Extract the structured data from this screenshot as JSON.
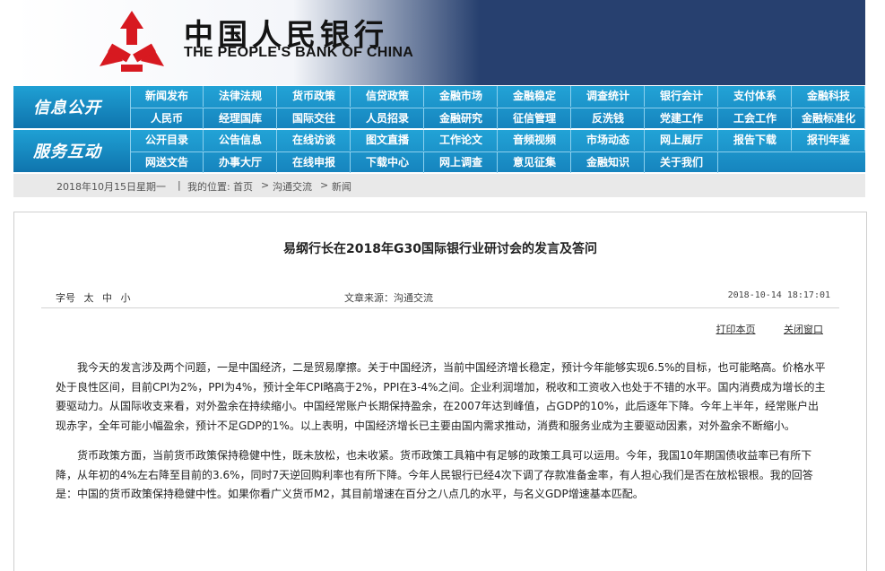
{
  "header": {
    "name_cn": "中国人民银行",
    "name_en": "THE PEOPLE'S BANK OF CHINA",
    "logo_color": "#d71920"
  },
  "nav": [
    {
      "section": "信息公开",
      "rows": [
        [
          "新闻发布",
          "法律法规",
          "货币政策",
          "信贷政策",
          "金融市场",
          "金融稳定",
          "调查统计",
          "银行会计",
          "支付体系",
          "金融科技"
        ],
        [
          "人民币",
          "经理国库",
          "国际交往",
          "人员招录",
          "金融研究",
          "征信管理",
          "反洗钱",
          "党建工作",
          "工会工作",
          "金融标准化"
        ]
      ]
    },
    {
      "section": "服务互动",
      "rows": [
        [
          "公开目录",
          "公告信息",
          "在线访谈",
          "图文直播",
          "工作论文",
          "音频视频",
          "市场动态",
          "网上展厅",
          "报告下载",
          "报刊年鉴"
        ],
        [
          "网送文告",
          "办事大厅",
          "在线申报",
          "下载中心",
          "网上调查",
          "意见征集",
          "金融知识",
          "关于我们"
        ]
      ]
    }
  ],
  "breadcrumb": {
    "date": "2018年10月15日",
    "weekday": "星期一",
    "sep": "|",
    "location_label": "我的位置:",
    "home": "首页",
    "arrow": ">",
    "level1": "沟通交流",
    "level2": "新闻"
  },
  "article": {
    "title": "易纲行长在2018年G30国际银行业研讨会的发言及答问",
    "font_size_label": "字号",
    "font_sizes": [
      "太",
      "中",
      "小"
    ],
    "source": "文章来源：沟通交流",
    "datetime": "2018-10-14 18:17:01",
    "print_label": "打印本页",
    "close_label": "关闭窗口",
    "paragraphs": [
      "我今天的发言涉及两个问题，一是中国经济，二是贸易摩擦。关于中国经济，当前中国经济增长稳定，预计今年能够实现6.5%的目标，也可能略高。价格水平处于良性区间，目前CPI为2%，PPI为4%，预计全年CPI略高于2%，PPI在3-4%之间。企业利润增加，税收和工资收入也处于不错的水平。国内消费成为增长的主要驱动力。从国际收支来看，对外盈余在持续缩小。中国经常账户长期保持盈余，在2007年达到峰值，占GDP的10%，此后逐年下降。今年上半年，经常账户出现赤字，全年可能小幅盈余，预计不足GDP的1%。以上表明，中国经济增长已主要由国内需求推动，消费和服务业成为主要驱动因素，对外盈余不断缩小。",
      "货币政策方面，当前货币政策保持稳健中性，既未放松，也未收紧。货币政策工具箱中有足够的政策工具可以运用。今年，我国10年期国债收益率已有所下降，从年初的4%左右降至目前的3.6%，同时7天逆回购利率也有所下降。今年人民银行已经4次下调了存款准备金率，有人担心我们是否在放松银根。我的回答是：中国的货币政策保持稳健中性。如果你看广义货币M2，其目前增速在百分之八点几的水平，与名义GDP增速基本匹配。"
    ]
  }
}
